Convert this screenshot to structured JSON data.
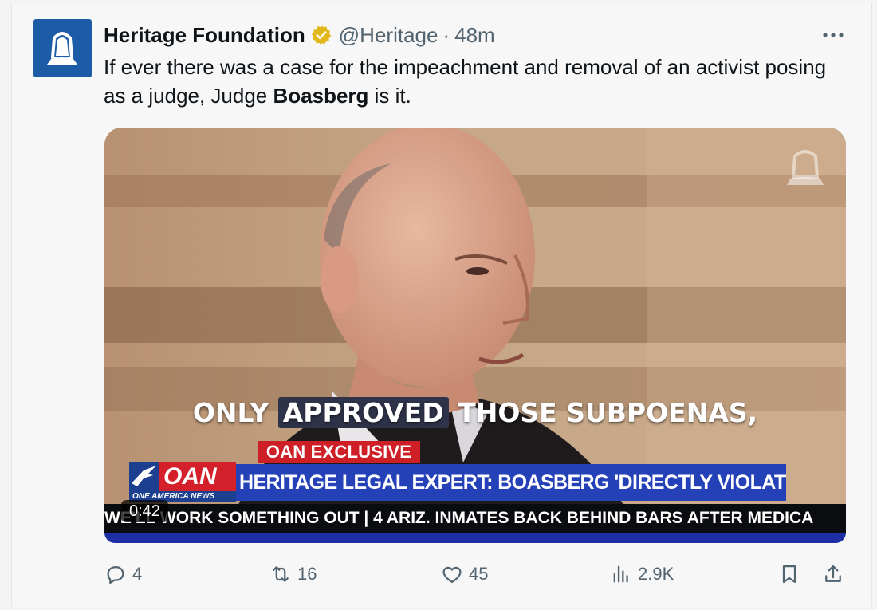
{
  "tweet": {
    "author_name": "Heritage Foundation",
    "handle": "@Heritage",
    "separator": "·",
    "time": "48m",
    "text_before": "If ever there was a case for the impeachment and removal of an activist posing as a judge, Judge ",
    "text_bold": "Boasberg",
    "text_after": " is it."
  },
  "video": {
    "caption_pre": "ONLY ",
    "caption_highlight": "APPROVED",
    "caption_post": " THOSE SUBPOENAS,",
    "exclusive_label": "OAN EXCLUSIVE",
    "network_logo": "OAN",
    "network_subtitle": "ONE AMERICA NEWS",
    "headline": "HERITAGE LEGAL EXPERT: BOASBERG 'DIRECTLY VIOLATED FEDERAL LAW'",
    "ticker": "WE'LL WORK SOMETHING OUT  |  4 ARIZ. INMATES BACK BEHIND BARS AFTER MEDICA",
    "duration": "0:42"
  },
  "actions": {
    "replies": "4",
    "reposts": "16",
    "likes": "45",
    "views": "2.9K"
  },
  "icons": {
    "avatar": "liberty-bell-logo",
    "verified": "verified-badge-gold",
    "more": "more-dots-icon",
    "reply": "reply-icon",
    "repost": "repost-icon",
    "like": "heart-icon",
    "views": "views-icon",
    "bookmark": "bookmark-icon",
    "share": "share-icon"
  },
  "colors": {
    "brand_blue": "#1c5ba5",
    "verified_gold": "#e2b719",
    "muted_text": "#536471",
    "oan_red": "#cf1f26",
    "oan_blue": "#2541b8"
  }
}
